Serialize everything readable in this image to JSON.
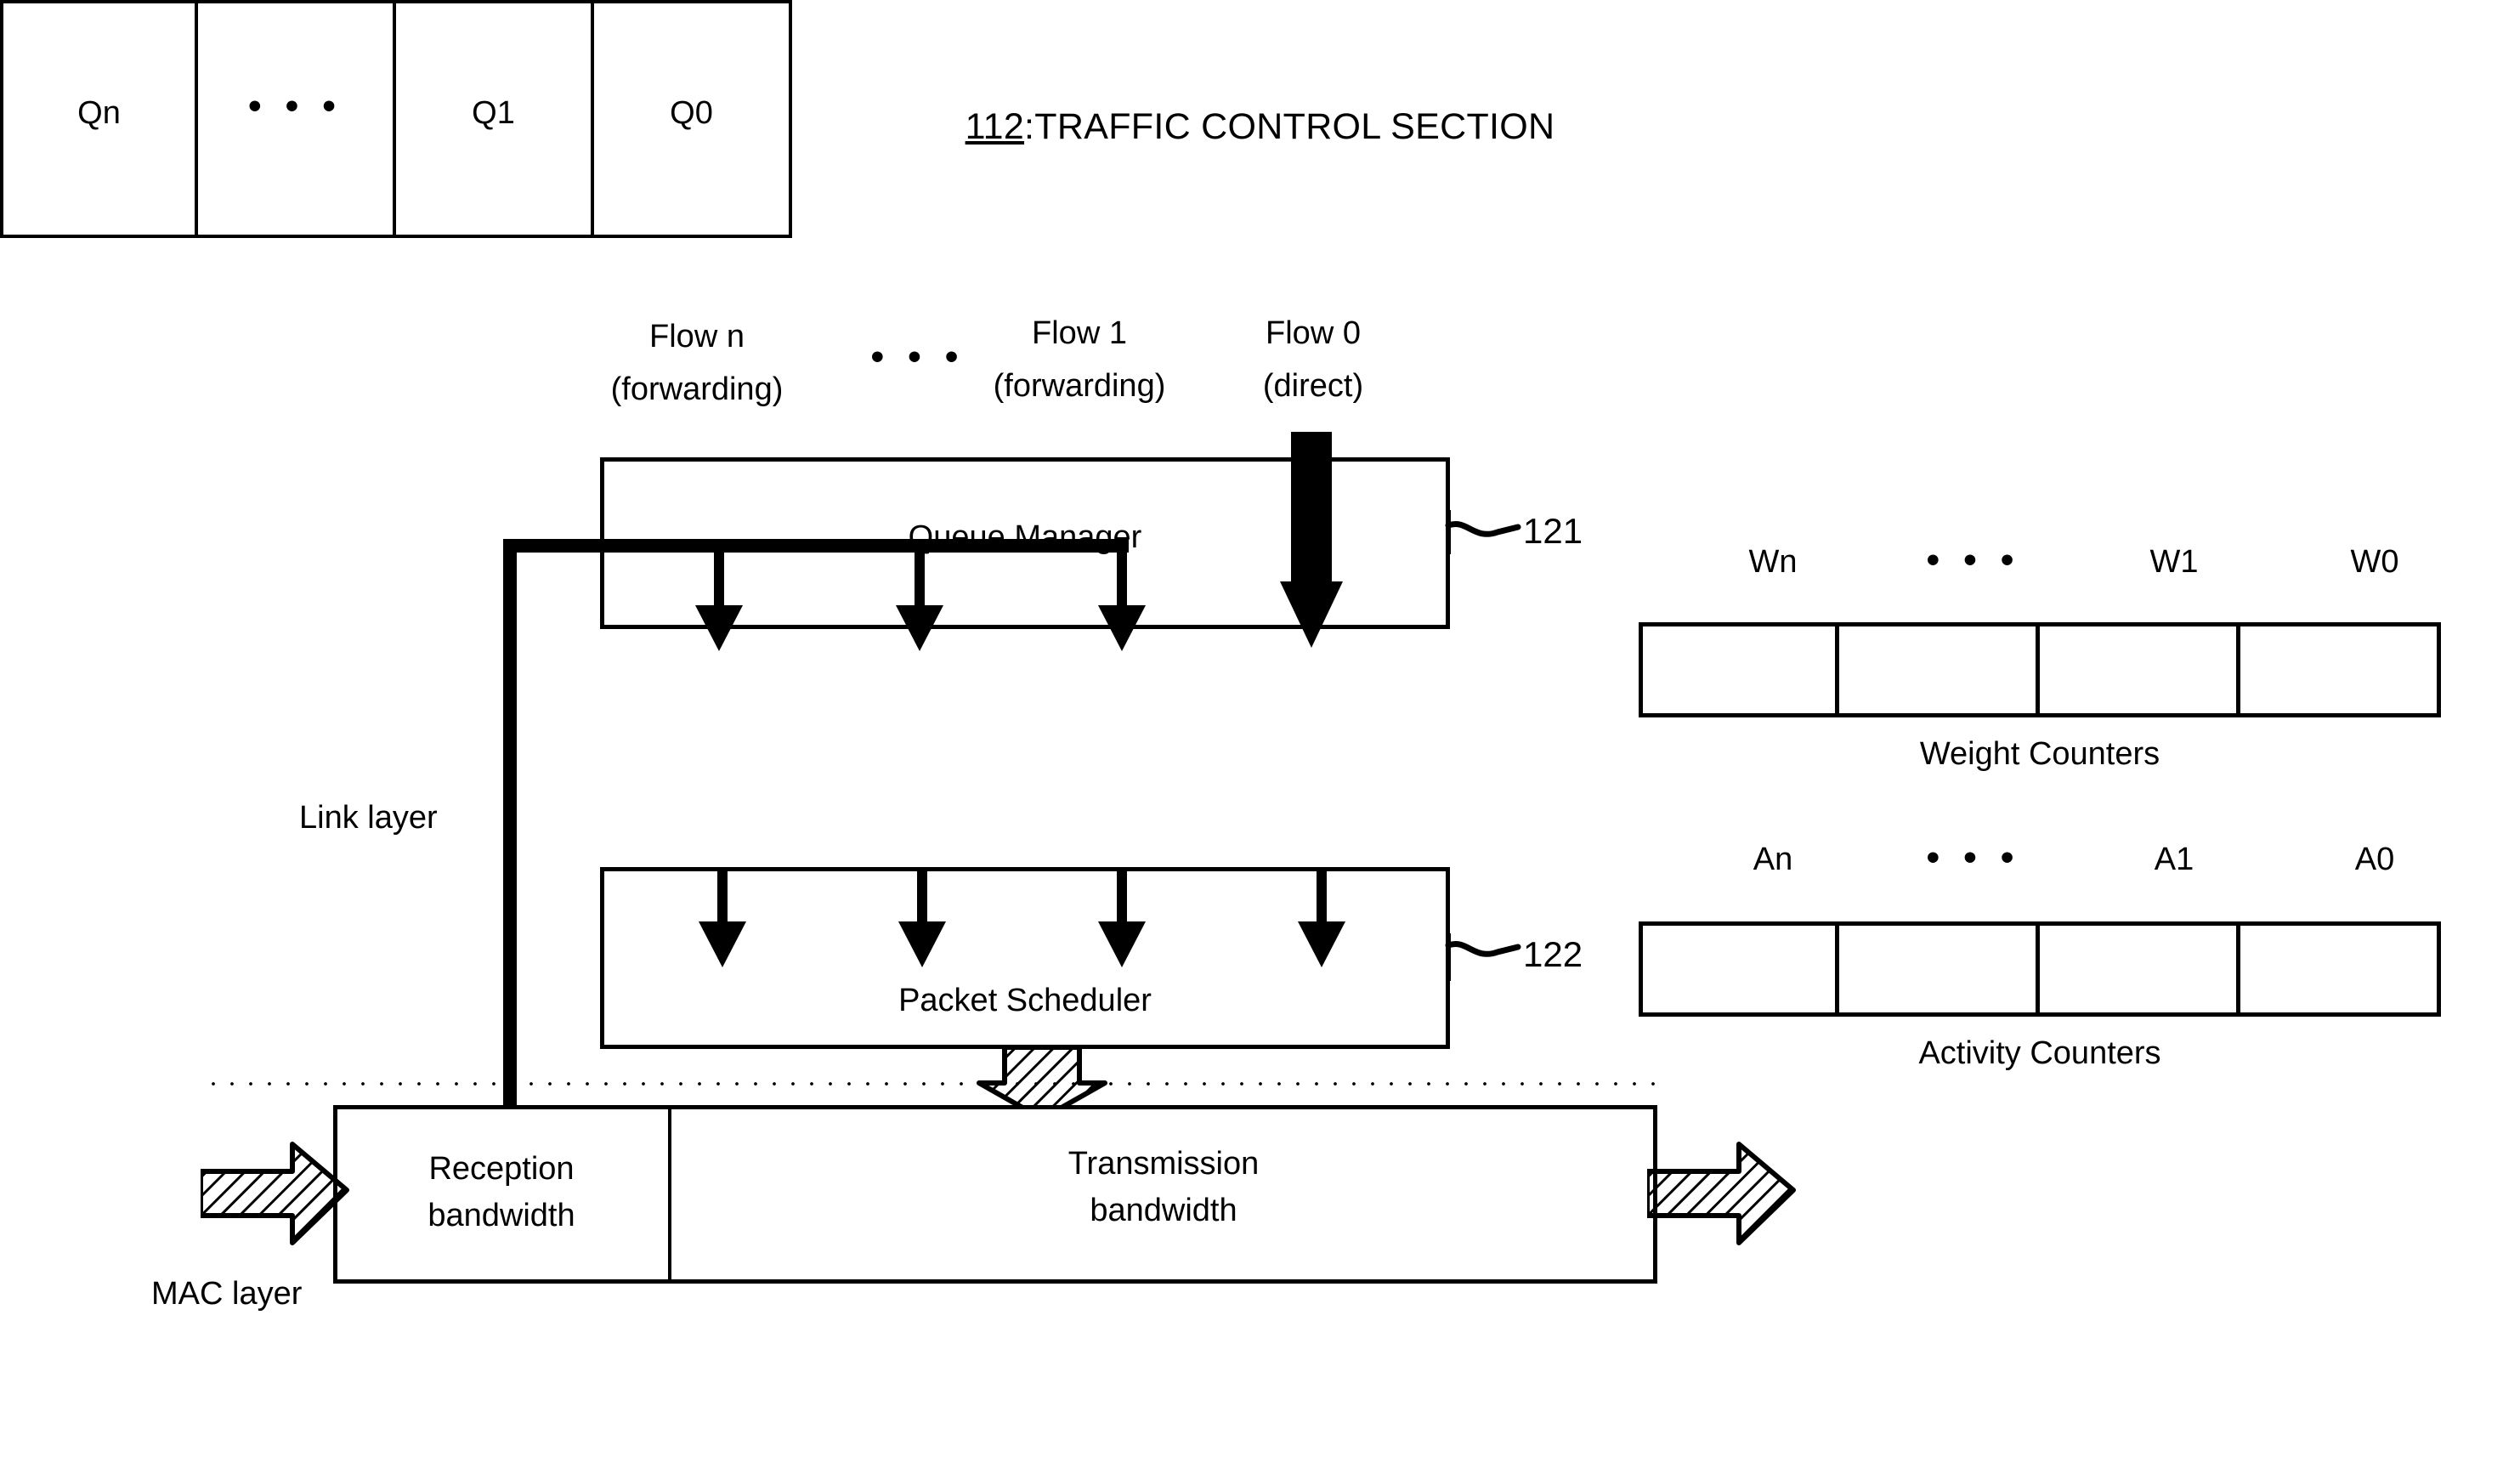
{
  "title": {
    "ref": "112",
    "text": ":TRAFFIC CONTROL SECTION"
  },
  "flows": [
    {
      "name": "Flow n",
      "mode": "(forwarding)"
    },
    {
      "name": "• • •",
      "mode": ""
    },
    {
      "name": "Flow 1",
      "mode": "(forwarding)"
    },
    {
      "name": "Flow 0",
      "mode": "(direct)"
    }
  ],
  "blocks": {
    "queue_manager": "Queue Manager",
    "packet_scheduler": "Packet Scheduler",
    "queue_manager_ref": "121",
    "packet_scheduler_ref": "122"
  },
  "queues": [
    "Qn",
    "• • •",
    "Q1",
    "Q0"
  ],
  "layers": {
    "link": "Link layer",
    "mac": "MAC layer"
  },
  "bandwidth": {
    "reception_line1": "Reception",
    "reception_line2": "bandwidth",
    "transmission_line1": "Transmission",
    "transmission_line2": "bandwidth"
  },
  "weight_counters": {
    "caption": "Weight Counters",
    "headers": [
      "Wn",
      "• • •",
      "W1",
      "W0"
    ]
  },
  "activity_counters": {
    "caption": "Activity Counters",
    "headers": [
      "An",
      "• • •",
      "A1",
      "A0"
    ]
  },
  "colors": {
    "ink": "#000000",
    "paper": "#ffffff"
  }
}
